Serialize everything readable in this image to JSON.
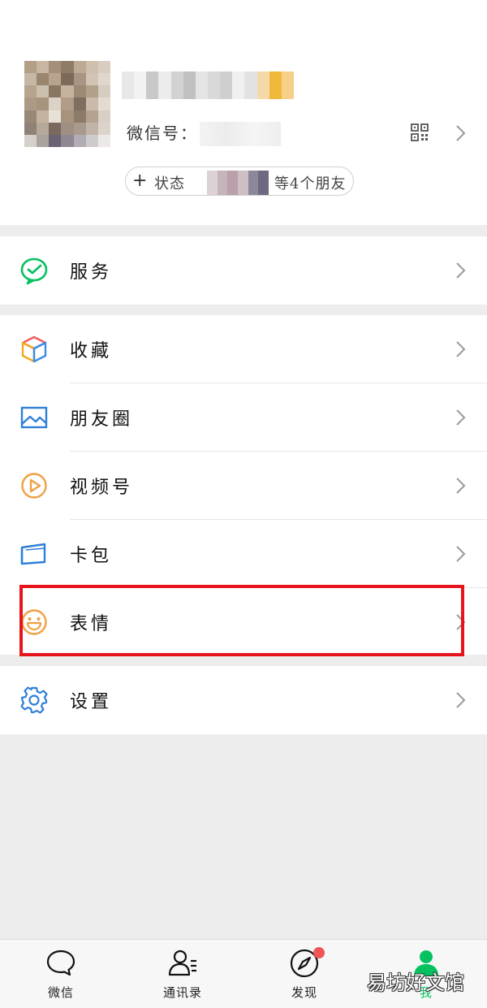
{
  "profile": {
    "wechat_id_label": "微信号：",
    "status_button_label": "状态",
    "status_suffix": "等4个朋友",
    "qr_icon": "qr-code-icon",
    "avatar_blur_colors": [
      "#b49e86",
      "#c8b6a3",
      "#a48f7a",
      "#8f7b66",
      "#bcaa95",
      "#cfc0ae",
      "#d8cdc0",
      "#c6b8a6",
      "#9a856f",
      "#b8a48e",
      "#7d6a58",
      "#a99581",
      "#d1c4b4",
      "#e0d7cc",
      "#b7a48f",
      "#cdbfae",
      "#8a7662",
      "#c5b39e",
      "#9d8a76",
      "#b3a08a",
      "#d6ccbf",
      "#ad9a86",
      "#a8937d",
      "#ddd2c6",
      "#b09c87",
      "#7f6e5f",
      "#c9bba9",
      "#e3dbd1",
      "#998876",
      "#c3b3a0",
      "#e8e1d8",
      "#a7927c",
      "#8d7b69",
      "#b4a28f",
      "#d9cfc4",
      "#8f8175",
      "#b7a999",
      "#7a6a5e",
      "#9e8f82",
      "#a89a8d",
      "#c0b4a8",
      "#dcd4cb",
      "#d6d0ca",
      "#aaa39c",
      "#6a6373",
      "#8f8893",
      "#b2adb4",
      "#cfcbcd",
      "#ebe8e6"
    ],
    "nick_blur_colors": [
      "#e8e8e8",
      "#f2f2f2",
      "#c9c9c9",
      "#ececec",
      "#d2d2d2",
      "#c1c1c1",
      "#e4e4e4",
      "#d9d9d9",
      "#cfcfcf",
      "#f0f0f0",
      "#e2e2e2",
      "#f5d9a8",
      "#f0b93c",
      "#f6d089"
    ],
    "status_blur_colors": [
      "#dcd2d6",
      "#c6b4bb",
      "#b9a0ab",
      "#cdbfc4",
      "#8e8699",
      "#6f6880"
    ]
  },
  "menu": {
    "services": {
      "label": "服务",
      "icon": "services-icon"
    },
    "favorites": {
      "label": "收藏",
      "icon": "favorites-cube-icon"
    },
    "moments": {
      "label": "朋友圈",
      "icon": "moments-picture-icon"
    },
    "channels": {
      "label": "视频号",
      "icon": "channels-play-icon"
    },
    "cards": {
      "label": "卡包",
      "icon": "card-wallet-icon"
    },
    "stickers": {
      "label": "表情",
      "icon": "sticker-smile-icon"
    },
    "settings": {
      "label": "设置",
      "icon": "settings-gear-icon"
    }
  },
  "tabbar": {
    "chats": {
      "label": "微信",
      "icon": "chat-bubble-icon"
    },
    "contacts": {
      "label": "通讯录",
      "icon": "contacts-icon"
    },
    "discover": {
      "label": "发现",
      "icon": "compass-icon"
    },
    "me": {
      "label": "我",
      "icon": "person-icon"
    }
  },
  "watermark": "易坊好文馆",
  "colors": {
    "wechat_green": "#07c160",
    "highlight_red": "#e8141c",
    "badge_red": "#f15656",
    "background": "#ededed"
  }
}
